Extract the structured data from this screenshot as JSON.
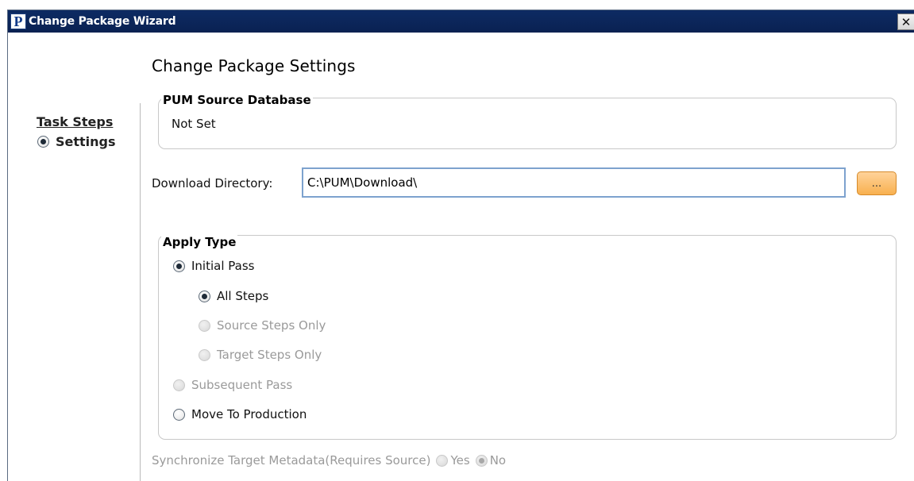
{
  "window": {
    "app_icon_letter": "P",
    "title": "Change Package Wizard",
    "close_glyph": "✕"
  },
  "page_title": "Change Package Settings",
  "sidebar": {
    "heading": "Task Steps",
    "steps": [
      {
        "label": "Settings",
        "selected": true
      }
    ]
  },
  "source_db": {
    "legend": "PUM Source Database",
    "value": "Not Set"
  },
  "download": {
    "label": "Download Directory:",
    "value": "C:\\PUM\\Download\\",
    "browse_label": "..."
  },
  "apply_type": {
    "legend": "Apply Type",
    "options": {
      "initial_pass": {
        "label": "Initial Pass",
        "checked": true,
        "enabled": true
      },
      "all_steps": {
        "label": "All Steps",
        "checked": true,
        "enabled": true
      },
      "source_steps_only": {
        "label": "Source Steps Only",
        "checked": false,
        "enabled": false
      },
      "target_steps_only": {
        "label": "Target Steps Only",
        "checked": false,
        "enabled": false
      },
      "subsequent_pass": {
        "label": "Subsequent Pass",
        "checked": false,
        "enabled": false
      },
      "move_to_production": {
        "label": "Move To Production",
        "checked": false,
        "enabled": true
      }
    }
  },
  "sync": {
    "label": "Synchronize Target Metadata(Requires Source)",
    "yes_label": "Yes",
    "no_label": "No",
    "selected": "No",
    "enabled": false
  },
  "colors": {
    "titlebar": "#0d2b63",
    "browse_button": "#f8b04f",
    "input_border": "#7da2ce",
    "disabled_text": "#9a9a9a"
  }
}
